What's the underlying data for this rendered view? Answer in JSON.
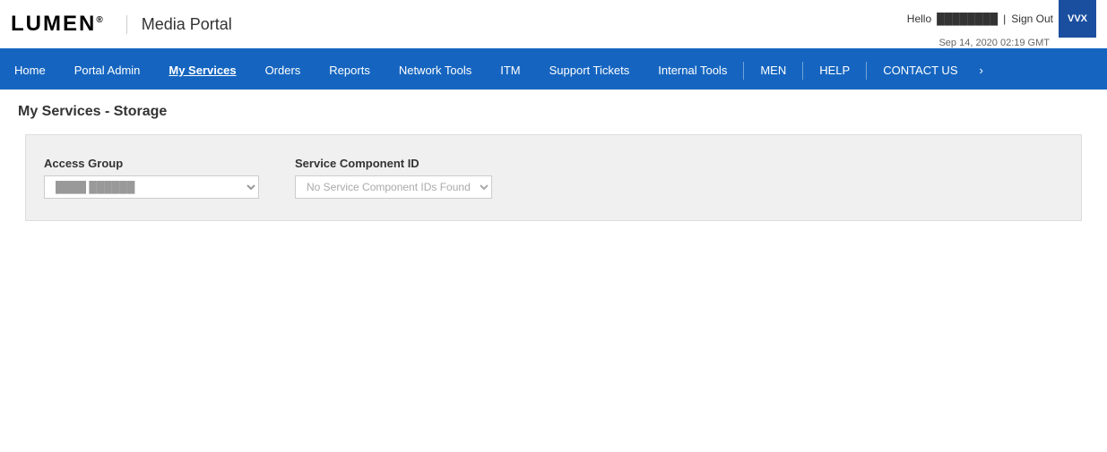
{
  "header": {
    "logo": "LUMEN",
    "reg_mark": "®",
    "portal_title": "Media Portal",
    "user": {
      "hello_text": "Hello",
      "username": "████████",
      "sign_out_label": "Sign Out",
      "datetime": "Sep 14, 2020 02:19 GMT"
    },
    "vvx_label": "VVX"
  },
  "navbar": {
    "items": [
      {
        "label": "Home",
        "active": false
      },
      {
        "label": "Portal Admin",
        "active": false
      },
      {
        "label": "My Services",
        "active": true
      },
      {
        "label": "Orders",
        "active": false
      },
      {
        "label": "Reports",
        "active": false
      },
      {
        "label": "Network Tools",
        "active": false
      },
      {
        "label": "ITM",
        "active": false
      },
      {
        "label": "Support Tickets",
        "active": false
      },
      {
        "label": "Internal Tools",
        "active": false
      },
      {
        "label": "MEN",
        "active": false
      },
      {
        "label": "HELP",
        "active": false
      },
      {
        "label": "CONTACT US",
        "active": false
      }
    ]
  },
  "page": {
    "title": "My Services - Storage"
  },
  "filter": {
    "access_group_label": "Access Group",
    "access_group_placeholder": "████ ██████",
    "service_comp_id_label": "Service Component ID",
    "service_comp_id_placeholder": "No Service Component IDs Found"
  }
}
